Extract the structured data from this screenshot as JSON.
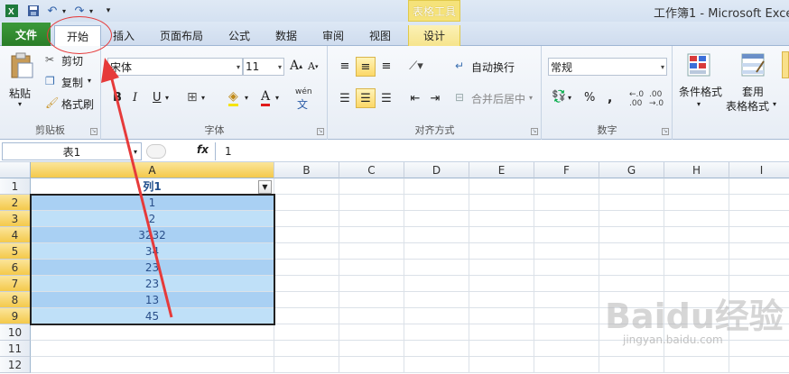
{
  "window": {
    "title": "工作簿1 - Microsoft Excel",
    "contextual_tab_group": "表格工具"
  },
  "quick_access": {
    "save_icon": "save-icon",
    "undo_icon": "undo-icon",
    "redo_icon": "redo-icon",
    "customize_icon": "customize-icon"
  },
  "tabs": [
    {
      "label": "文件"
    },
    {
      "label": "开始"
    },
    {
      "label": "插入"
    },
    {
      "label": "页面布局"
    },
    {
      "label": "公式"
    },
    {
      "label": "数据"
    },
    {
      "label": "审阅"
    },
    {
      "label": "视图"
    },
    {
      "label": "设计"
    }
  ],
  "ribbon": {
    "clipboard": {
      "label": "剪贴板",
      "paste": "粘贴",
      "cut": "剪切",
      "copy": "复制",
      "format_painter": "格式刷"
    },
    "font": {
      "label": "字体",
      "font_name": "宋体",
      "font_size": "11",
      "bold": "B",
      "italic": "I",
      "underline": "U",
      "grow": "A",
      "shrink": "A",
      "font_color": "A",
      "phonetic": "wén"
    },
    "alignment": {
      "label": "对齐方式",
      "wrap_text": "自动换行",
      "merge_center": "合并后居中"
    },
    "number": {
      "label": "数字",
      "format": "常规",
      "percent": "%",
      "comma": ","
    },
    "styles": {
      "conditional_format": "条件格式",
      "apply_table_format_1": "套用",
      "apply_table_format_2": "表格格式"
    }
  },
  "formula_bar": {
    "name_box": "表1",
    "fx": "fx",
    "value": "1"
  },
  "sheet": {
    "columns": [
      "A",
      "B",
      "C",
      "D",
      "E",
      "F",
      "G",
      "H",
      "I"
    ],
    "rows": [
      "1",
      "2",
      "3",
      "4",
      "5",
      "6",
      "7",
      "8",
      "9",
      "10",
      "11",
      "12"
    ],
    "column_a": [
      "列1",
      "1",
      "2",
      "3232",
      "34",
      "23",
      "23",
      "13",
      "45",
      "",
      "",
      ""
    ]
  },
  "watermark": {
    "text": "Baidu经验",
    "sub": "jingyan.baidu.com"
  },
  "colors": {
    "file_tab": "#2a7d28",
    "table_band_dark": "#a9d0f3",
    "table_band_light": "#bfe0f8",
    "annotation_red": "#e63a3a",
    "selected_header": "#f4c94b"
  }
}
